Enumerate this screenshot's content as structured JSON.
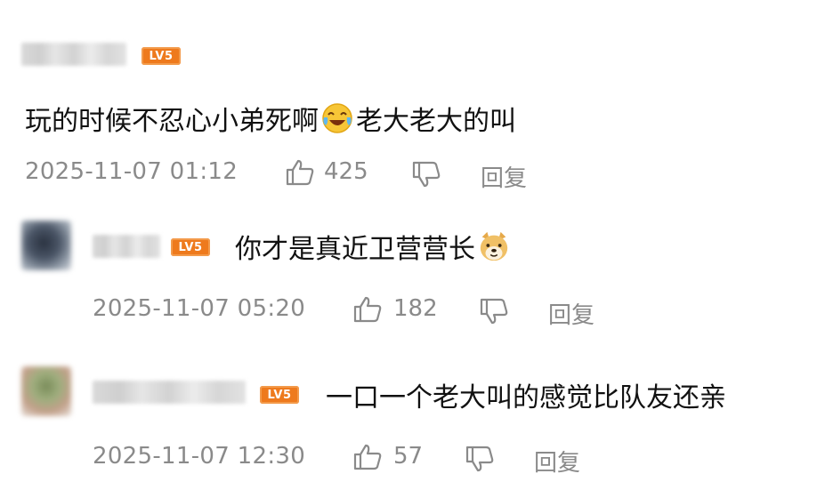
{
  "comments": [
    {
      "level_badge": "LV5",
      "text_before": "玩的时候不忍心小弟死啊",
      "emoji": "crying-laughing-emoji",
      "text_after": "老大老大的叫",
      "time": "2025-11-07 01:12",
      "likes": "425",
      "reply_label": "回复"
    },
    {
      "level_badge": "LV5",
      "text_before": "你才是真近卫营营长",
      "emoji": "doge-emoji",
      "text_after": "",
      "time": "2025-11-07 05:20",
      "likes": "182",
      "reply_label": "回复"
    },
    {
      "level_badge": "LV5",
      "text_before": "一口一个老大叫的感觉比队友还亲",
      "emoji": "",
      "text_after": "",
      "time": "2025-11-07 12:30",
      "likes": "57",
      "reply_label": "回复"
    }
  ],
  "colors": {
    "badge": "#ee7a1d",
    "meta_text": "#8a8a8a",
    "body_text": "#111111"
  }
}
